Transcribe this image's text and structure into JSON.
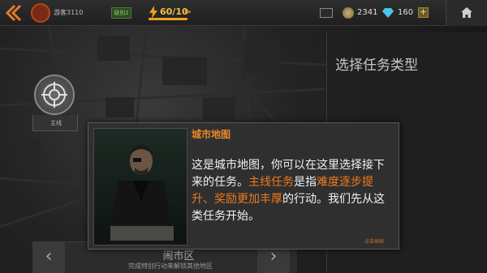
{
  "topbar": {
    "player_name": "游客3110",
    "level": "级别2",
    "energy": "60/10",
    "energy_fraction": 1.0,
    "coins": "2341",
    "gems": "160"
  },
  "map": {
    "main_quest_label": "主线"
  },
  "right_panel": {
    "title": "选择任务类型"
  },
  "district": {
    "name": "闹市区",
    "description": "完成特别行动来解锁其他地区"
  },
  "dialog": {
    "title": "城市地图",
    "text_1": "这是城市地图，你可以在这里选择接下来的任务。",
    "highlight_1": "主线任务",
    "text_2": "是指",
    "highlight_2": "难度逐步提升、奖励更加丰厚",
    "text_3": "的行动。我们先从这类任务开始。",
    "continue_hint": "点击继续"
  },
  "colors": {
    "accent_orange": "#f07a1c",
    "energy": "#f0a020",
    "gem": "#4ac6e8"
  },
  "icons": [
    "back-arrow-icon",
    "faction-emblem-icon",
    "lightning-icon",
    "mail-icon",
    "coin-icon",
    "gem-icon",
    "home-icon",
    "crosshair-icon"
  ]
}
